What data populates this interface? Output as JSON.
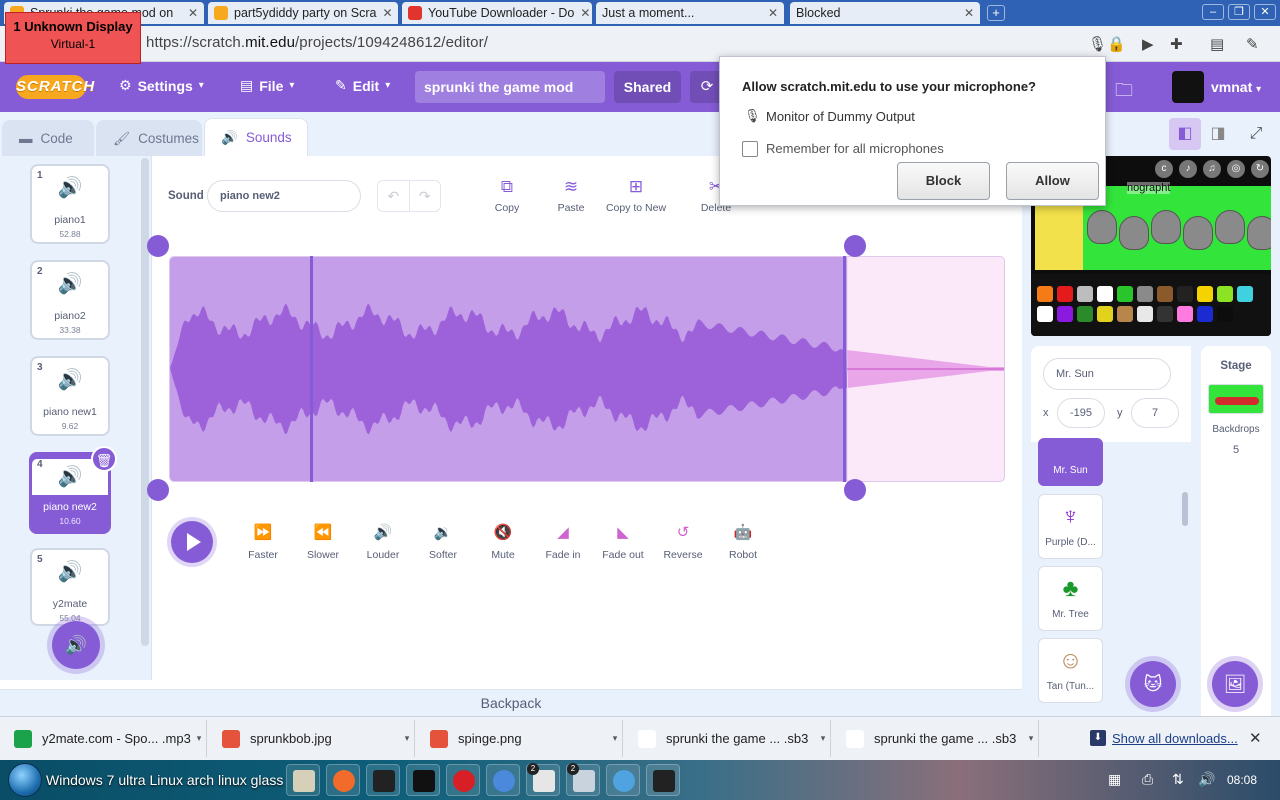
{
  "browser": {
    "tabs": [
      {
        "title": "Sprunki the game mod on",
        "fav": "#f7a81e"
      },
      {
        "title": "part5ydiddy party on Scra",
        "fav": "#f7a81e"
      },
      {
        "title": "YouTube Downloader - Do",
        "fav": "#e0342c"
      },
      {
        "title": "Just a moment...",
        "fav": "#9aa6b8"
      },
      {
        "title": "Blocked",
        "fav": "#9aa6b8"
      }
    ],
    "tab_close": "✕",
    "new_tab": "+",
    "window_controls": {
      "minimize": "–",
      "restore": "❐",
      "close": "✕"
    },
    "display_badge": {
      "line1": "1  Unknown Display",
      "line2": "Virtual-1"
    },
    "url_prefix": "https://scratch.",
    "url_host": "mit.edu",
    "url_path": "/projects/1094248612/editor/"
  },
  "menubar": {
    "logo": "SCRATCH",
    "settings": "Settings",
    "file": "File",
    "edit": "Edit",
    "project_title": "sprunki the game mod",
    "shared": "Shared",
    "username": "vmnat",
    "caret": "▾"
  },
  "editor_tabs": {
    "code": "Code",
    "costumes": "Costumes",
    "sounds": "Sounds"
  },
  "sounds": [
    {
      "num": "1",
      "name": "piano1",
      "duration": "52.88"
    },
    {
      "num": "2",
      "name": "piano2",
      "duration": "33.38"
    },
    {
      "num": "3",
      "name": "piano new1",
      "duration": "9.62"
    },
    {
      "num": "4",
      "name": "piano new2",
      "duration": "10.60"
    },
    {
      "num": "5",
      "name": "y2mate",
      "duration": "55.04"
    }
  ],
  "selected_sound_index": 3,
  "sound_editor": {
    "sound_label": "Sound",
    "sound_name": "piano new2",
    "tools": {
      "copy": "Copy",
      "paste": "Paste",
      "copy_to_new": "Copy to New",
      "delete": "Delete"
    },
    "effects": {
      "faster": "Faster",
      "slower": "Slower",
      "louder": "Louder",
      "softer": "Softer",
      "mute": "Mute",
      "fade_in": "Fade in",
      "fade_out": "Fade out",
      "reverse": "Reverse",
      "robot": "Robot"
    },
    "selection": {
      "start": 0.0,
      "end": 0.81
    }
  },
  "mic_popup": {
    "title": "Allow scratch.mit.edu to use your microphone?",
    "device": "Monitor of Dummy Output",
    "remember": "Remember for all microphones",
    "remember_checked": false,
    "block": "Block",
    "allow": "Allow"
  },
  "stage": {
    "title_fragment": "nographt"
  },
  "sprite_info": {
    "name": "Mr. Sun",
    "x_label": "x",
    "x_value": "-195",
    "y_label": "y",
    "y_value": "7"
  },
  "sprites": [
    {
      "name": "Mr. Sun",
      "selected": true
    },
    {
      "name": "Purple (D...",
      "selected": false
    },
    {
      "name": "Mr. Tree",
      "selected": false
    },
    {
      "name": "Tan (Tun...",
      "selected": false
    }
  ],
  "stage_panel": {
    "title": "Stage",
    "backdrops_label": "Backdrops",
    "backdrops_count": "5"
  },
  "backpack": "Backpack",
  "downloads": {
    "items": [
      {
        "name": "y2mate.com - Spo... .mp3",
        "color": "#1aa34a"
      },
      {
        "name": "sprunkbob.jpg",
        "color": "#e5533c"
      },
      {
        "name": "spinge.png",
        "color": "#e5533c"
      },
      {
        "name": "sprunki the game ... .sb3",
        "color": "#ffffff"
      },
      {
        "name": "sprunki the game ... .sb3",
        "color": "#ffffff"
      }
    ],
    "show_all": "Show all downloads...",
    "close": "✕"
  },
  "taskbar": {
    "start_text": "Windows 7 ultra Linux arch linux glass",
    "badge_a": "2",
    "badge_b": "2",
    "time": "08:08"
  },
  "colors": {
    "accent": "#855cd6",
    "effect": "#cf63cf",
    "waveform_fill": "#c59ee9",
    "waveform_dim": "#e9a7e9"
  }
}
